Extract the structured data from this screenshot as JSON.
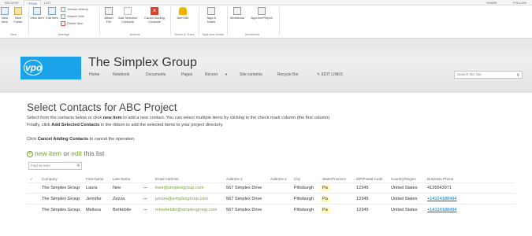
{
  "topbar": {
    "tabs": [
      "BROWSE",
      "ITEMS",
      "LIST"
    ],
    "right": [
      "SHARE",
      "FOLLOW"
    ]
  },
  "ribbon": {
    "new_group": {
      "cmd1": "New Item",
      "cmd2": "New Folder",
      "label": "New"
    },
    "manage_group": {
      "view": "View Item",
      "edit": "Edit Item",
      "version": "Version History",
      "shared": "Shared With",
      "delete": "Delete Item",
      "label": "Manage"
    },
    "actions_group": {
      "attach": "Attach File",
      "add_selected": "Add Selected Contacts",
      "cancel_adding": "Cancel Adding Contacts",
      "label": "Actions"
    },
    "share_group": {
      "alert": "Alert Me",
      "label": "Share & Track"
    },
    "tags_group": {
      "tags": "Tags & Notes",
      "label": "Tags and Notes"
    },
    "workflows_group": {
      "workflows": "Workflows",
      "approve": "Approve/Reject",
      "label": "Workflows"
    }
  },
  "site": {
    "logo_text": "vpo",
    "title": "The Simplex Group",
    "nav": [
      "Home",
      "Notebook",
      "Documents",
      "Pages",
      "Recent",
      "Site contents",
      "Recycle Bin",
      "EDIT LINKS"
    ],
    "search_placeholder": "Search this site"
  },
  "page": {
    "title": "Select Contacts for ABC Project",
    "desc1a": "Select from the contacts below or click ",
    "desc1b": "new item",
    "desc1c": " to add a new contact. You can select multiple items by clicking in the check mark column (the first column).",
    "desc2a": "Finally, click ",
    "desc2b": "Add Selected Contacts",
    "desc2c": " in the ribbon to add the selected items to your project directory.",
    "desc3a": "Click ",
    "desc3b": "Cancel Adding Contacts",
    "desc3c": " to cancel the operation.",
    "new_item": "new item",
    "or": " or ",
    "edit": "edit",
    "this_list": " this list",
    "find_placeholder": "Find an item"
  },
  "table": {
    "headers": [
      "Company",
      "First Name",
      "Last Name",
      "Email Address",
      "Address 1",
      "Address 2",
      "City",
      "State/Province",
      "ZIP/Postal Code",
      "Country/Region",
      "Business Phone"
    ],
    "rows": [
      {
        "company": "The Simplex Group",
        "first": "Laura",
        "last": "Nee",
        "email": "lnee@simplexgroup.com",
        "addr1": "567 Simplex Drive",
        "city": "Pittsburgh",
        "state": "Pa",
        "zip": "12345",
        "country": "United States",
        "phone": "4126543971"
      },
      {
        "company": "The Simplex Group",
        "first": "Jennifer",
        "last": "Zezza",
        "email": "jzezza@simplexgroup.com",
        "addr1": "567 Simplex Drive",
        "city": "Pittsburgh",
        "state": "Pa",
        "zip": "12345",
        "country": "United States",
        "phone": "+14124188494"
      },
      {
        "company": "The Simplex Group",
        "first": "Melissa",
        "last": "Berkebile",
        "email": "mberkebile@simplexgroup.com",
        "addr1": "567 Simplex Drive",
        "city": "Pittsburgh",
        "state": "Pa",
        "zip": "12345",
        "country": "United States",
        "phone": "+14124188494"
      }
    ],
    "more": "..."
  },
  "colors": {
    "accent": "#0072c6",
    "green": "#77a22e",
    "logo": "#1aa3e8",
    "cancel_red": "#d9412b",
    "alert_yellow": "#f0b400"
  }
}
